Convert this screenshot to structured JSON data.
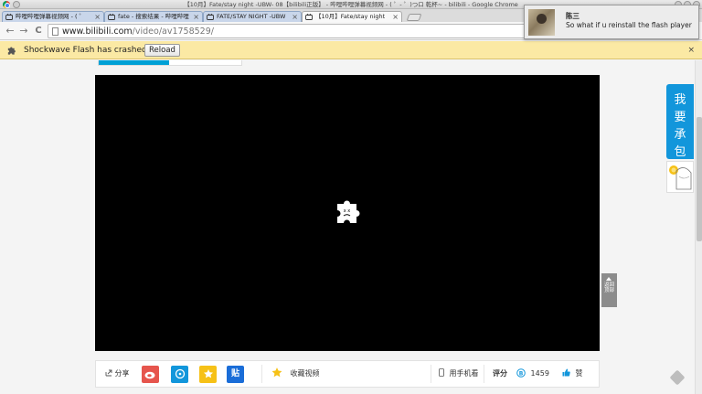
{
  "window": {
    "title": "【10月】Fate/stay night -UBW- 08【bilibili正版】 - 哔哩哔哩弹幕视频网 - ( ゜- ゜)つロ 乾杯~ - bilibili - Google Chrome"
  },
  "tabs": [
    {
      "label": "哔哩哔哩弹幕视频网 - ( ゜"
    },
    {
      "label": "fate - 搜索结果 - 哔哩哔哩"
    },
    {
      "label": "FATE/STAY NIGHT -UBW"
    },
    {
      "label": "【10月】Fate/stay night"
    }
  ],
  "tab_close": "×",
  "toolbar": {
    "back": "←",
    "forward": "→",
    "reload": "C",
    "url_host": "www.bilibili.com",
    "url_path": "/video/av1758529/"
  },
  "infobar": {
    "message": "Shockwave Flash has crashed.",
    "reload_label": "Reload",
    "close": "×"
  },
  "notification": {
    "sender": "陈三",
    "message": "So what if u reinstall the flash player"
  },
  "actions": {
    "share_label": "分享",
    "tieba_label": "贴",
    "favorite_label": "收藏视频",
    "mobile_label": "用手机看",
    "rating_label": "评分",
    "coins": "1459",
    "like_label": "赞"
  },
  "sidebar": {
    "promo_line1": "我",
    "promo_line2": "要",
    "promo_line3": "承",
    "promo_line4": "包",
    "back_top_line1": "返回",
    "back_top_line2": "顶部"
  },
  "colors": {
    "accent": "#00a1d6",
    "infobar": "#fbe9a4",
    "weibo": "#e6554d",
    "star": "#f6c117"
  }
}
